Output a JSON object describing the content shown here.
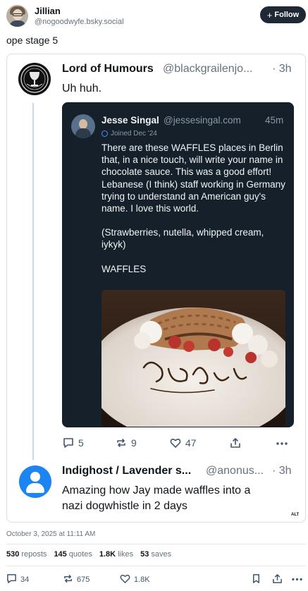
{
  "post": {
    "author_name": "Jillian",
    "author_handle": "@nogoodwyfe.bsky.social",
    "follow_label": "Follow",
    "text": "ope stage 5"
  },
  "quoted_reply": {
    "author_name": "Lord of Humours",
    "author_handle": "@blackgrailenjo...",
    "time": "· 3h",
    "text": "Uh huh.",
    "embed": {
      "author_name": "Jesse Singal",
      "author_handle": "@jessesingal.com",
      "time": "45m",
      "joined": "Joined Dec '24",
      "paragraphs": [
        "There are these WAFFLES places in Berlin that, in a nice touch, will write your name in chocolate sauce. This was a good effort! Lebanese (I think) staff working in Germany trying to understand an American guy's name. I love this world.",
        "(Strawberries, nutella, whipped cream, iykyk)",
        "WAFFLES"
      ],
      "photo_script_text": "Jassy"
    },
    "actions": {
      "replies": "5",
      "reposts": "9",
      "likes": "47"
    }
  },
  "second_reply": {
    "author_name": "Indighost / Lavender s...",
    "author_handle": "@anonus...",
    "time": "· 3h",
    "text_line1": "Amazing how Jay made waffles into a",
    "text_line2": "nazi dogwhistle in 2 days"
  },
  "alt_badge": "ALT",
  "timestamp": "October 3, 2025 at 11:11 AM",
  "stats": {
    "reposts_count": "530",
    "reposts_label": "reposts",
    "quotes_count": "145",
    "quotes_label": "quotes",
    "likes_count": "1.8K",
    "likes_label": "likes",
    "saves_count": "53",
    "saves_label": "saves"
  },
  "bottom_actions": {
    "replies": "34",
    "reposts": "675",
    "likes": "1.8K"
  },
  "icons": {
    "reply": "speech-bubble-icon",
    "repost": "repost-arrows-icon",
    "like": "heart-icon",
    "share": "share-icon",
    "more": "ellipsis-icon",
    "bookmark": "bookmark-icon",
    "verified": "verified-badge-icon"
  },
  "colors": {
    "embed_background": "#15202b",
    "follow_button": "#1e2935",
    "indighost_avatar": "#1d85f2",
    "thread_line": "#c9d8e6"
  }
}
